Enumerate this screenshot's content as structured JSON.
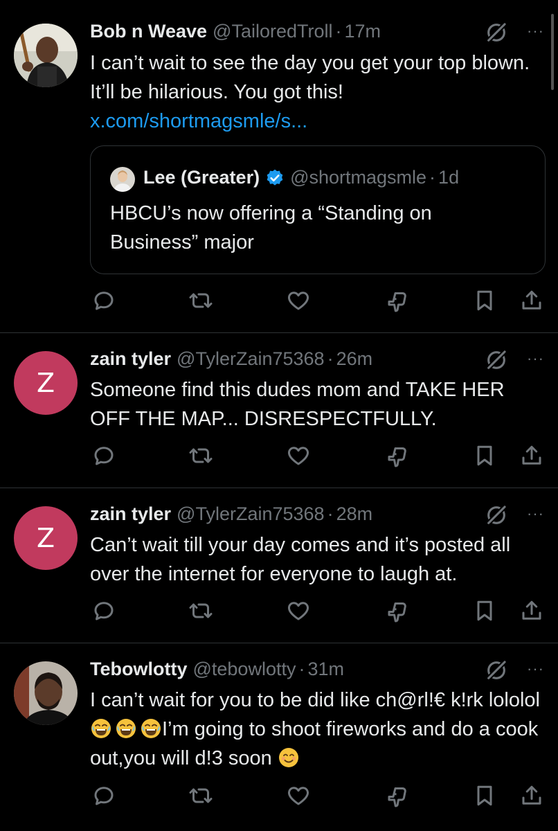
{
  "tweets": [
    {
      "name": "Bob n Weave",
      "handle": "@TailoredTroll",
      "time": "17m",
      "text": "I can’t wait to see the day you get your top blown. It’ll be hilarious. You got this! ",
      "link": "x.com/shortmagsmle/s...",
      "avatar": "photo",
      "quote": {
        "name": "Lee (Greater)",
        "handle": "@shortmagsmle",
        "time": "1d",
        "text": "HBCU’s now offering a “Standing on Business” major"
      }
    },
    {
      "name": "zain tyler",
      "handle": "@TylerZain75368",
      "time": "26m",
      "text": "Someone find this dudes mom and TAKE HER OFF THE MAP... DISRESPECTFULLY.",
      "avatar_letter": "Z"
    },
    {
      "name": "zain tyler",
      "handle": "@TylerZain75368",
      "time": "28m",
      "text": "Can’t wait till your day comes and it’s posted all over the internet for everyone to laugh at.",
      "avatar_letter": "Z"
    },
    {
      "name": "Tebowlotty",
      "handle": "@tebowlotty",
      "time": "31m",
      "text_part1": "I can’t wait for you to be did like ch@rl!€ k!rk lololol",
      "text_part2": "I’m going to shoot fireworks and do a cook out,you will d!3 soon",
      "avatar": "photo"
    }
  ],
  "separator": "·",
  "more_label": "···",
  "icons": [
    "grok-icon",
    "more-icon",
    "reply-icon",
    "repost-icon",
    "like-icon",
    "views-icon",
    "bookmark-icon",
    "share-icon",
    "verified-icon",
    "laughing-emoji-icon",
    "smiling-emoji-icon"
  ],
  "colors": {
    "background": "#000000",
    "text": "#e7e9ea",
    "muted": "#71767b",
    "link": "#1d9bf0",
    "verified": "#1d9bf0",
    "avatar_letter_bg": "#c13a5e",
    "border": "#2f3336"
  }
}
